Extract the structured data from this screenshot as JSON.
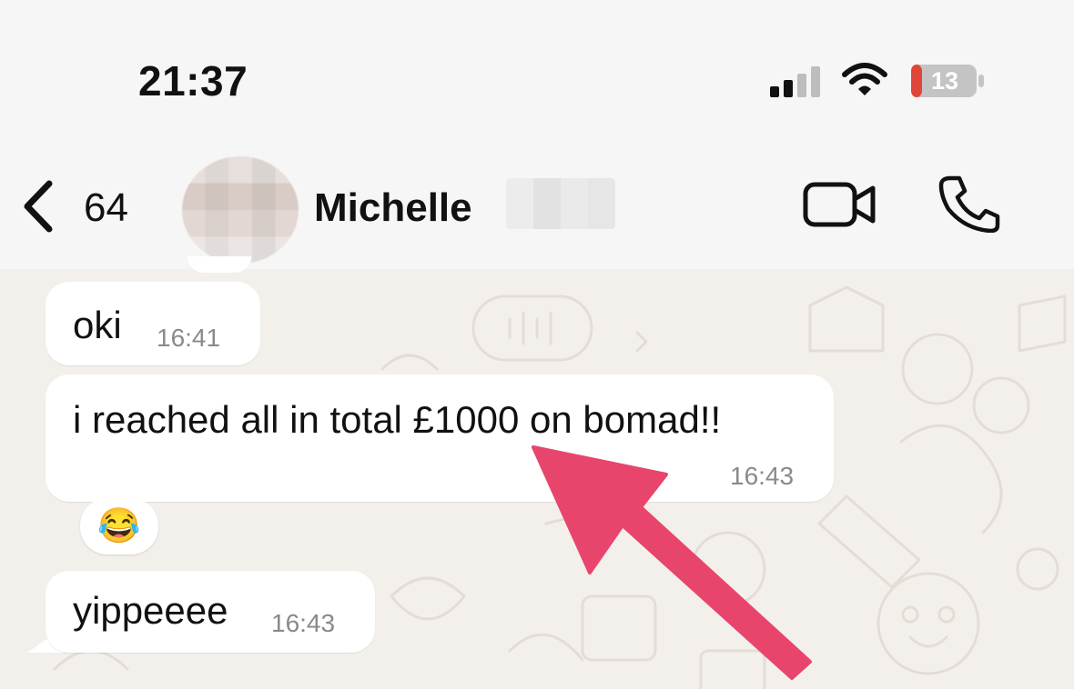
{
  "status_bar": {
    "time": "21:37",
    "battery_percent": "13",
    "battery_color": "#e0453a",
    "icons": [
      "cellular-signal-icon",
      "wifi-icon",
      "battery-icon"
    ]
  },
  "header": {
    "back_count": "64",
    "contact_name": "Michelle",
    "icons": [
      "back-chevron-icon",
      "video-call-icon",
      "phone-call-icon"
    ]
  },
  "messages": [
    {
      "text": "oki",
      "time": "16:41",
      "direction": "incoming"
    },
    {
      "text": "i reached all in total £1000 on bomad!!",
      "time": "16:43",
      "direction": "incoming",
      "reaction": "😂"
    },
    {
      "text": "yippeeee",
      "time": "16:43",
      "direction": "incoming"
    }
  ],
  "annotation": {
    "type": "arrow",
    "color": "#e8456d",
    "points_to": "£1000"
  },
  "colors": {
    "header_bg": "#f6f6f6",
    "chat_bg": "#f3f0ec",
    "bubble_incoming": "#ffffff",
    "arrow": "#e8456d"
  }
}
